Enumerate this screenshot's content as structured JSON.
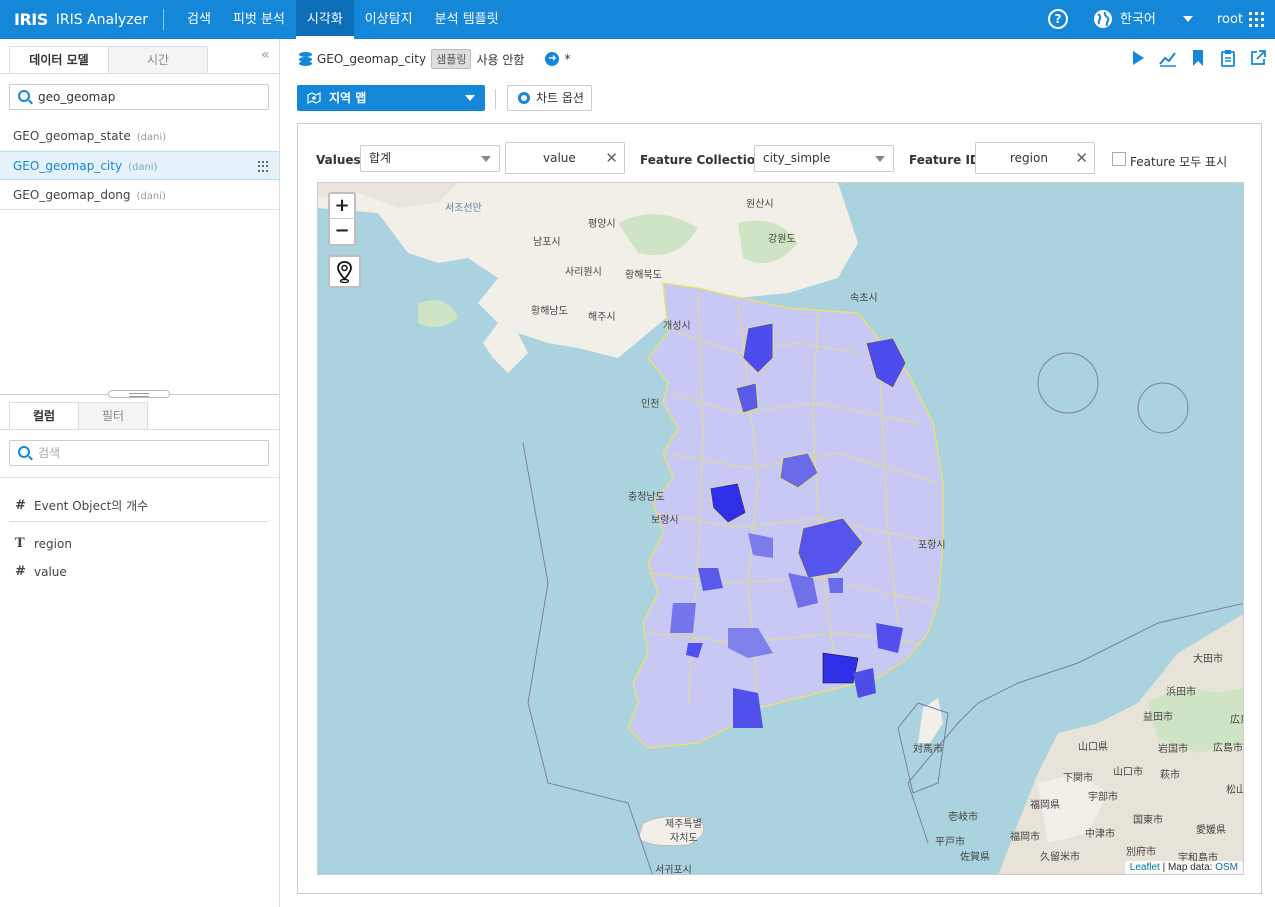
{
  "header": {
    "logo": "IRIS",
    "app_name": "IRIS Analyzer",
    "nav": [
      {
        "label": "검색"
      },
      {
        "label": "피벗 분석"
      },
      {
        "label": "시각화"
      },
      {
        "label": "이상탐지"
      },
      {
        "label": "분석 템플릿"
      }
    ],
    "active_nav": "시각화",
    "help_icon": "?",
    "language": "한국어",
    "user": "root"
  },
  "left_panel": {
    "tabs": [
      "데이터 모델",
      "시간"
    ],
    "search_value": "geo_geomap",
    "models": [
      {
        "name": "GEO_geomap_state",
        "owner": "(dani)"
      },
      {
        "name": "GEO_geomap_city",
        "owner": "(dani)",
        "selected": true
      },
      {
        "name": "GEO_geomap_dong",
        "owner": "(dani)"
      }
    ],
    "column_tabs": [
      "컬럼",
      "필터"
    ],
    "column_search_placeholder": "검색",
    "columns": [
      {
        "type_icon": "#",
        "name": "Event Object의 개수"
      },
      {
        "type_icon": "T",
        "name": "region"
      },
      {
        "type_icon": "#",
        "name": "value"
      }
    ]
  },
  "breadcrumb": {
    "model": "GEO_geomap_city",
    "sampling_badge": "샘플링",
    "sampling_status": "사용 안함",
    "arrow_icon": "➜",
    "modified_mark": "*"
  },
  "toolbar": {
    "chart_type": "지역 맵",
    "chart_options": "차트 옵션"
  },
  "filters": {
    "values_label": "Values",
    "values_agg": "합계",
    "values_field": "value",
    "feature_collection_label": "Feature Collection",
    "feature_collection_value": "city_simple",
    "feature_id_label": "Feature ID",
    "feature_id_value": "region",
    "show_all_label": "Feature 모두 표시",
    "show_all_checked": false
  },
  "map": {
    "zoom_in": "+",
    "zoom_out": "−",
    "attribution_leaflet": "Leaflet",
    "attribution_sep": " | Map data: ",
    "attribution_osm": "OSM",
    "labels": {
      "pyongyang": "평양시",
      "nampo": "남포시",
      "sariwon": "사리원시",
      "hwangbuk": "황해북도",
      "hwangnam": "황해남도",
      "haeju": "해주시",
      "kaesong": "개성시",
      "wonsan": "원산시",
      "gangwon_n": "강원도",
      "sokcho": "속초시",
      "incheon": "인천",
      "west_sea": "서조선만",
      "boryeong": "보령시",
      "chungnam": "충청남도",
      "jeju1": "제주특별",
      "jeju2": "자치도",
      "seogwipo": "서귀포시",
      "tsushima": "対馬市",
      "ulsan": "포항시",
      "iki": "壱岐市",
      "hirado": "平戸市",
      "sasebo": "佐賀県",
      "fukuoka": "福岡市",
      "kurume": "久留米市",
      "fukuoka_pref": "福岡県",
      "yamaguchi_pref": "山口県",
      "shimonoseki": "下関市",
      "ube": "宇部市",
      "yamaguchi": "山口市",
      "nakatsu": "中津市",
      "kunisaki": "国東市",
      "beppu": "別府市",
      "hagi": "萩市",
      "masuda": "益田市",
      "hamada": "浜田市",
      "daisen": "大田市",
      "hiroshima_pref": "広島県",
      "hiroshima": "広島市",
      "iwakuni": "岩国市",
      "ehime": "愛媛県",
      "uwajima": "宇和島市",
      "matsuyama": "松山",
      "hiro": "広島"
    }
  },
  "colors": {
    "accent": "#1587d8",
    "choropleth_light": "#c8c8f4",
    "choropleth_mid": "#7575ec",
    "choropleth_dark": "#2f2fe8",
    "boundary": "#f0e35a",
    "sea": "#aad3df",
    "land": "#f2efe9"
  }
}
